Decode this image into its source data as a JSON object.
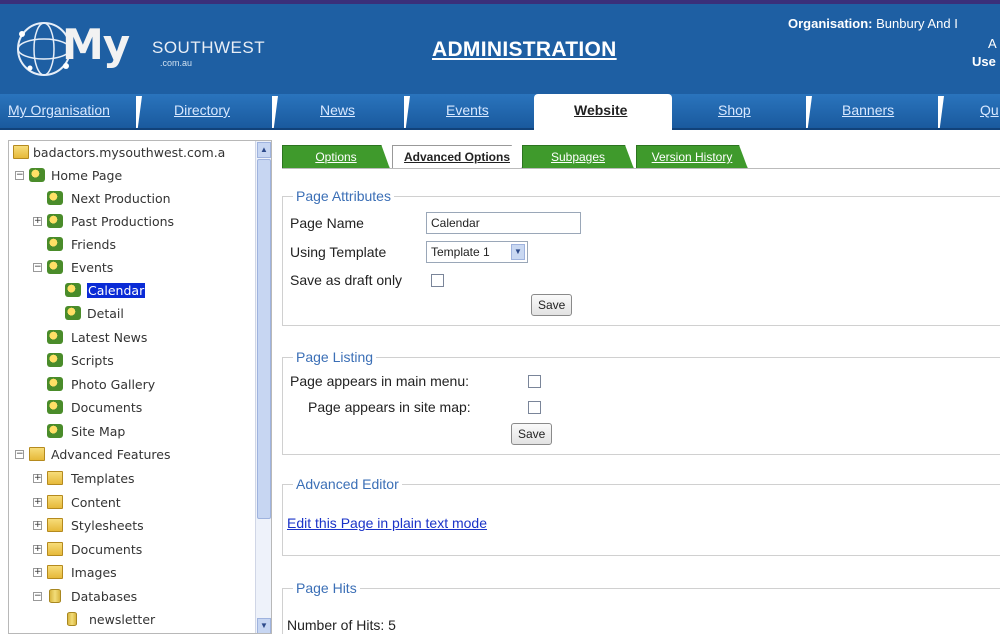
{
  "header": {
    "logo_my": "My",
    "logo_southwest": "SOUTHWEST",
    "logo_domain": ".com.au",
    "title": "ADMINISTRATION",
    "org_label": "Organisation:",
    "org_value": "Bunbury And I",
    "line2_fragment": "A",
    "user_fragment": "Use"
  },
  "nav": {
    "items": [
      "My Organisation",
      "Directory",
      "News",
      "Events",
      "Website",
      "Shop",
      "Banners",
      "Qu"
    ],
    "active": "Website"
  },
  "sidebar": {
    "root": "badactors.mysouthwest.com.a",
    "items": [
      {
        "label": "Home Page"
      },
      {
        "label": "Next Production"
      },
      {
        "label": "Past Productions"
      },
      {
        "label": "Friends"
      },
      {
        "label": "Events"
      },
      {
        "label": "Calendar"
      },
      {
        "label": "Detail"
      },
      {
        "label": "Latest News"
      },
      {
        "label": "Scripts"
      },
      {
        "label": "Photo Gallery"
      },
      {
        "label": "Documents"
      },
      {
        "label": "Site Map"
      },
      {
        "label": "Advanced Features"
      },
      {
        "label": "Templates"
      },
      {
        "label": "Content"
      },
      {
        "label": "Stylesheets"
      },
      {
        "label": "Documents"
      },
      {
        "label": "Images"
      },
      {
        "label": "Databases"
      },
      {
        "label": "newsletter"
      }
    ]
  },
  "tabs": [
    "Options",
    "Advanced Options",
    "Subpages",
    "Version History"
  ],
  "page_attributes": {
    "legend": "Page Attributes",
    "page_name_label": "Page Name",
    "page_name_value": "Calendar",
    "template_label": "Using Template",
    "template_value": "Template 1",
    "draft_label": "Save as draft only",
    "save_label": "Save"
  },
  "page_listing": {
    "legend": "Page Listing",
    "main_menu_label": "Page appears in main menu:",
    "site_map_label": "Page appears in site map:",
    "save_label": "Save"
  },
  "advanced_editor": {
    "legend": "Advanced Editor",
    "link_text": "Edit this Page in plain text mode"
  },
  "page_hits": {
    "legend": "Page Hits",
    "hits_label": "Number of Hits: 5"
  },
  "colors": {
    "header_blue": "#1e5fa3",
    "nav_blue": "#2a74bd",
    "tab_green": "#3f9a2c",
    "legend_blue": "#3b6fb6",
    "selection_blue": "#0a2bd6"
  }
}
